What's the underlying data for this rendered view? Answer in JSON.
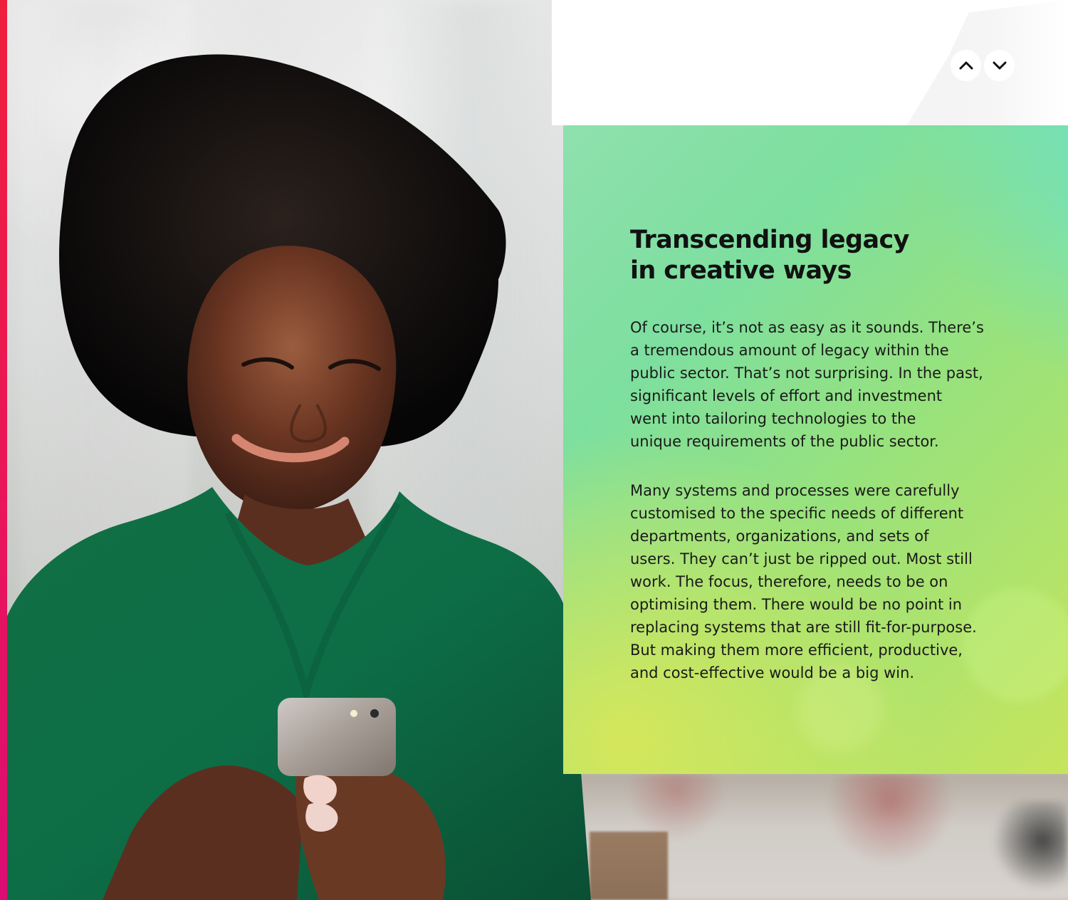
{
  "navigation": {
    "previous_icon": "chevron-up-icon",
    "next_icon": "chevron-down-icon"
  },
  "panel": {
    "title": "Transcending legacy\nin creative ways",
    "paragraphs": [
      "Of course, it’s not as easy as it sounds. There’s\na tremendous amount of legacy within the\npublic sector. That’s not surprising. In the past,\nsignificant levels of effort and investment\nwent into tailoring technologies to the\nunique requirements of the public sector.",
      "Many systems and processes were carefully\ncustomised to the specific needs of different\ndepartments, organizations, and sets of\nusers. They can’t just be ripped out. Most still\nwork. The focus, therefore, needs to be on\noptimising them. There would be no point in\nreplacing systems that are still fit-for-purpose.\nBut making them more efficient, productive,\nand cost-effective would be a big win."
    ]
  },
  "colors": {
    "accent_bar": "#ea1559",
    "panel_mint": "#80dfa2",
    "panel_lime": "#c7e45c",
    "text_primary": "#111111"
  }
}
